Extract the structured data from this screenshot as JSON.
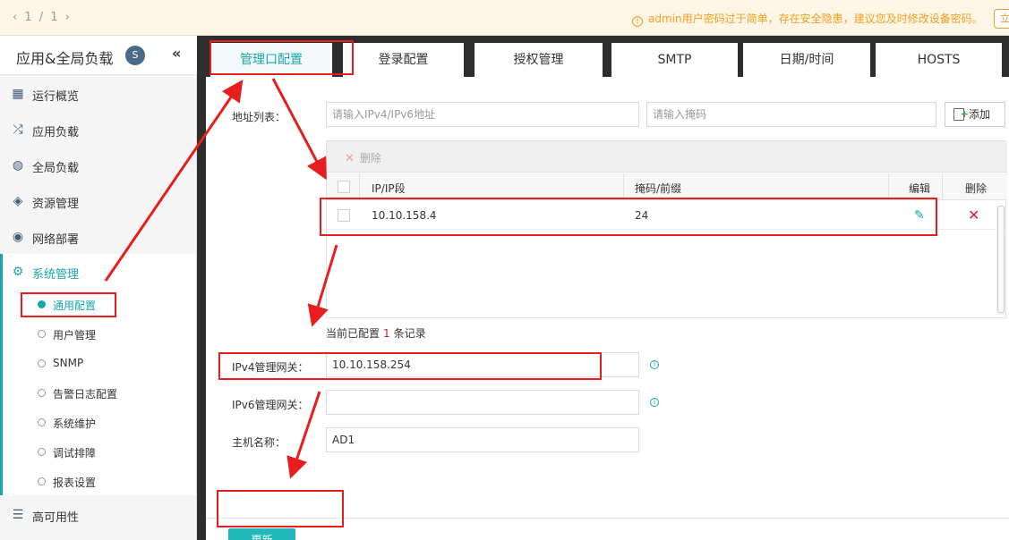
{
  "topbar": {
    "pager_prev": "‹",
    "pager_text": "1 / 1",
    "pager_next": "›",
    "warning": "admin用户密码过于简单，存在安全隐患，建议您及时修改设备密码。",
    "warning_icon": "info-circle-icon",
    "edge_button": "立"
  },
  "sidebar": {
    "title": "应用&全局负载",
    "collapse_glyph": "«",
    "logo_glyph": "S",
    "items": [
      {
        "label": "运行概览",
        "icon": "dashboard-icon"
      },
      {
        "label": "应用负载",
        "icon": "shuffle-icon"
      },
      {
        "label": "全局负载",
        "icon": "dns-globe-icon"
      },
      {
        "label": "资源管理",
        "icon": "layers-icon"
      },
      {
        "label": "网络部署",
        "icon": "globe-icon"
      },
      {
        "label": "系统管理",
        "icon": "gear-icon"
      }
    ],
    "sub_items": [
      {
        "label": "通用配置"
      },
      {
        "label": "用户管理"
      },
      {
        "label": "SNMP"
      },
      {
        "label": "告警日志配置"
      },
      {
        "label": "系统维护"
      },
      {
        "label": "调试排障"
      },
      {
        "label": "报表设置"
      }
    ],
    "bottom_item": {
      "label": "高可用性",
      "icon": "list-icon"
    }
  },
  "tabs": [
    {
      "label": "管理口配置"
    },
    {
      "label": "登录配置"
    },
    {
      "label": "授权管理"
    },
    {
      "label": "SMTP"
    },
    {
      "label": "日期/时间"
    },
    {
      "label": "HOSTS"
    }
  ],
  "form": {
    "address_list_label": "地址列表：",
    "ip_placeholder": "请输入IPv4/IPv6地址",
    "mask_placeholder": "请输入掩码",
    "add_button": "添加",
    "delete_button": "删除",
    "table": {
      "headers": {
        "ip": "IP/IP段",
        "mask": "掩码/前缀",
        "edit": "编辑",
        "delete": "删除"
      },
      "rows": [
        {
          "ip": "10.10.158.4",
          "mask": "24"
        }
      ]
    },
    "summary_prefix": "当前已配置",
    "summary_count": "1",
    "summary_suffix": "条记录",
    "ipv4_gateway_label": "IPv4管理网关：",
    "ipv4_gateway_value": "10.10.158.254",
    "ipv6_gateway_label": "IPv6管理网关：",
    "ipv6_gateway_value": "",
    "hostname_label": "主机名称：",
    "hostname_value": "AD1",
    "update_button": "更新"
  },
  "colors": {
    "accent": "#18a6a8",
    "annotation_red": "#e81e1e",
    "warning": "#f0a020",
    "dark_bar": "#2e2e2e"
  }
}
